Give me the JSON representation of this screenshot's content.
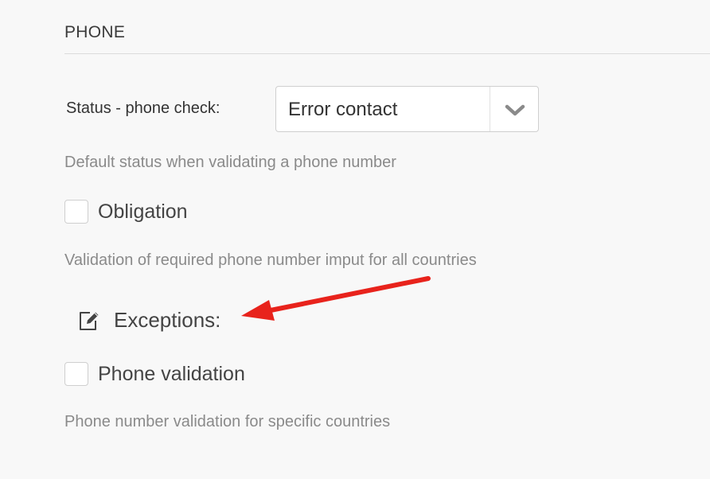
{
  "section": {
    "title": "PHONE"
  },
  "status_field": {
    "label": "Status - phone check:",
    "selected_value": "Error contact",
    "help": "Default status when validating a phone number"
  },
  "obligation": {
    "label": "Obligation",
    "checked": false,
    "help": "Validation of required phone number imput for all countries"
  },
  "exceptions": {
    "label": "Exceptions:",
    "icon": "edit-icon"
  },
  "phone_validation": {
    "label": "Phone validation",
    "checked": false,
    "help": "Phone number validation for specific countries"
  },
  "colors": {
    "annotation_arrow": "#e8231c"
  }
}
